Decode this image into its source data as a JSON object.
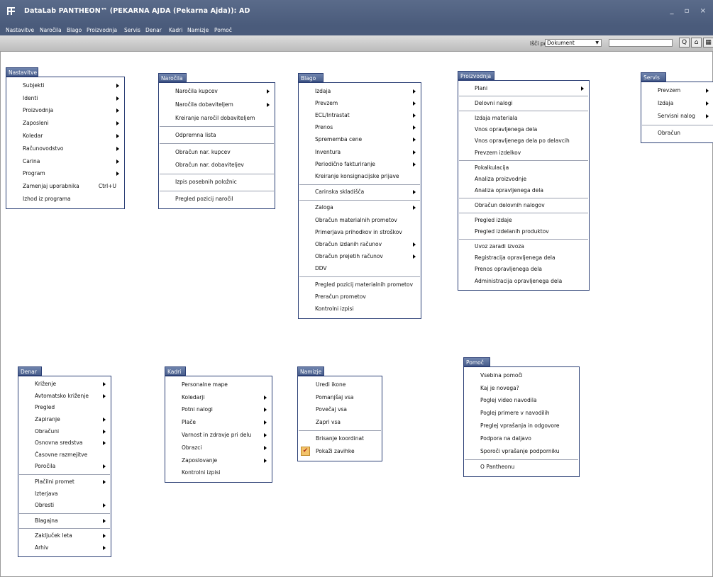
{
  "window": {
    "title": "DataLab PANTHEON™  (PEKARNA AJDA (Pekarna Ajda)): AD",
    "controls": "_ ▫ ×"
  },
  "menubar": [
    "Nastavitve",
    "Naročila",
    "Blago",
    "Proizvodnja",
    "Servis",
    "Denar",
    "Kadri",
    "Namizje",
    "Pomoč"
  ],
  "toolbar": {
    "search_label": "Išči po",
    "search_select": "Dokument",
    "buttons": [
      {
        "icon": "search-icon",
        "glyph": "Q"
      },
      {
        "icon": "home-icon",
        "glyph": "⌂"
      },
      {
        "icon": "window-icon",
        "glyph": "▦"
      }
    ]
  },
  "menus": [
    {
      "key": "nastavitve",
      "title": "Nastavitve",
      "items": [
        {
          "label": "Subjekti",
          "arrow": true
        },
        {
          "label": "Identi",
          "arrow": true
        },
        {
          "label": "Proizvodnja",
          "arrow": true
        },
        {
          "label": "Zaposleni",
          "arrow": true
        },
        {
          "label": "Koledar",
          "arrow": true
        },
        {
          "label": "Računovodstvo",
          "arrow": true
        },
        {
          "label": "Carina",
          "arrow": true
        },
        {
          "label": "Program",
          "arrow": true
        },
        {
          "label": "Zamenjaj uporabnika",
          "shortcut": "Ctrl+U"
        },
        {
          "label": "Izhod iz programa"
        }
      ]
    },
    {
      "key": "narocila",
      "title": "Naročila",
      "items": [
        {
          "label": "Naročila kupcev",
          "arrow": true
        },
        {
          "label": "Naročila dobaviteljem",
          "arrow": true
        },
        {
          "label": "Kreiranje naročil dobaviteljem"
        },
        {
          "sep": true
        },
        {
          "label": "Odpremna lista"
        },
        {
          "sep": true
        },
        {
          "label": "Obračun nar. kupcev"
        },
        {
          "label": "Obračun nar. dobaviteljev"
        },
        {
          "sep": true
        },
        {
          "label": "Izpis posebnih položnic"
        },
        {
          "sep": true
        },
        {
          "label": "Pregled pozicij naročil"
        }
      ]
    },
    {
      "key": "blago",
      "title": "Blago",
      "items": [
        {
          "label": "Izdaja",
          "arrow": true
        },
        {
          "label": "Prevzem",
          "arrow": true
        },
        {
          "label": "ECL/Intrastat",
          "arrow": true
        },
        {
          "label": "Prenos",
          "arrow": true
        },
        {
          "label": "Sprememba cene",
          "arrow": true
        },
        {
          "label": "Inventura",
          "arrow": true
        },
        {
          "label": "Periodično fakturiranje",
          "arrow": true
        },
        {
          "label": "Kreiranje konsignacijske prijave"
        },
        {
          "sep": true
        },
        {
          "label": "Carinska skladišča",
          "arrow": true
        },
        {
          "sep": true
        },
        {
          "label": "Zaloga",
          "arrow": true
        },
        {
          "label": "Obračun materialnih prometov"
        },
        {
          "label": "Primerjava prihodkov in stroškov"
        },
        {
          "label": "Obračun izdanih računov",
          "arrow": true
        },
        {
          "label": "Obračun prejetih računov",
          "arrow": true
        },
        {
          "label": "DDV"
        },
        {
          "sep": true
        },
        {
          "label": "Pregled pozicij materialnih prometov"
        },
        {
          "label": "Preračun prometov"
        },
        {
          "label": "Kontrolni izpisi"
        }
      ]
    },
    {
      "key": "proizvodnja",
      "title": "Proizvodnja",
      "items": [
        {
          "label": "Plani",
          "arrow": true
        },
        {
          "sep": true
        },
        {
          "label": "Delovni nalogi"
        },
        {
          "sep": true
        },
        {
          "label": "Izdaja materiala"
        },
        {
          "label": "Vnos opravljenega dela"
        },
        {
          "label": "Vnos opravljenega dela po delavcih"
        },
        {
          "label": "Prevzem izdelkov"
        },
        {
          "sep": true
        },
        {
          "label": "Pokalkulacija"
        },
        {
          "label": "Analiza proizvodnje"
        },
        {
          "label": "Analiza opravljenega dela"
        },
        {
          "sep": true
        },
        {
          "label": "Obračun delovnih nalogov"
        },
        {
          "sep": true
        },
        {
          "label": "Pregled izdaje"
        },
        {
          "label": "Pregled izdelanih produktov"
        },
        {
          "sep": true
        },
        {
          "label": "Uvoz zaradi izvoza"
        },
        {
          "label": "Registracija opravljenega dela"
        },
        {
          "label": "Prenos opravljenega dela"
        },
        {
          "label": "Administracija opravljenega dela"
        }
      ]
    },
    {
      "key": "servis",
      "title": "Servis",
      "items": [
        {
          "label": "Prevzem",
          "arrow": true
        },
        {
          "label": "Izdaja",
          "arrow": true
        },
        {
          "label": "Servisni nalog",
          "arrow": true
        },
        {
          "sep": true
        },
        {
          "label": "Obračun"
        }
      ]
    },
    {
      "key": "denar",
      "title": "Denar",
      "items": [
        {
          "label": "Križenje",
          "arrow": true
        },
        {
          "label": "Avtomatsko križenje",
          "arrow": true
        },
        {
          "label": "Pregled"
        },
        {
          "label": "Zapiranje",
          "arrow": true
        },
        {
          "label": "Obračuni",
          "arrow": true
        },
        {
          "label": "Osnovna sredstva",
          "arrow": true
        },
        {
          "label": "Časovne razmejitve"
        },
        {
          "label": "Poročila",
          "arrow": true
        },
        {
          "sep": true
        },
        {
          "label": "Plačilni promet",
          "arrow": true
        },
        {
          "label": "Izterjava"
        },
        {
          "label": "Obresti",
          "arrow": true
        },
        {
          "sep": true
        },
        {
          "label": "Blagajna",
          "arrow": true
        },
        {
          "sep": true
        },
        {
          "label": "Zaključek leta",
          "arrow": true
        },
        {
          "label": "Arhiv",
          "arrow": true
        }
      ]
    },
    {
      "key": "kadri",
      "title": "Kadri",
      "items": [
        {
          "label": "Personalne mape"
        },
        {
          "label": "Koledarji",
          "arrow": true
        },
        {
          "label": "Potni nalogi",
          "arrow": true
        },
        {
          "label": "Plače",
          "arrow": true
        },
        {
          "label": "Varnost in zdravje pri delu",
          "arrow": true
        },
        {
          "label": "Obrazci",
          "arrow": true
        },
        {
          "label": "Zaposlovanje",
          "arrow": true
        },
        {
          "label": "Kontrolni izpisi"
        }
      ]
    },
    {
      "key": "namizje",
      "title": "Namizje",
      "items": [
        {
          "label": "Uredi ikone"
        },
        {
          "label": "Pomanjšaj vsa"
        },
        {
          "label": "Povečaj vsa"
        },
        {
          "label": "Zapri vsa"
        },
        {
          "sep": true
        },
        {
          "label": "Brisanje koordinat"
        },
        {
          "label": "Pokaži zavihke",
          "checked": true
        }
      ]
    },
    {
      "key": "pomoc",
      "title": "Pomoč",
      "items": [
        {
          "label": "Vsebina pomoči"
        },
        {
          "label": "Kaj je novega?"
        },
        {
          "label": "Poglej video navodila"
        },
        {
          "label": "Poglej primere v navodilih"
        },
        {
          "label": "Preglej vprašanja in odgovore"
        },
        {
          "label": "Podpora na daljavo"
        },
        {
          "label": "Sporoči vprašanje podporniku"
        },
        {
          "sep": true
        },
        {
          "label": "O Pantheonu"
        }
      ]
    }
  ]
}
